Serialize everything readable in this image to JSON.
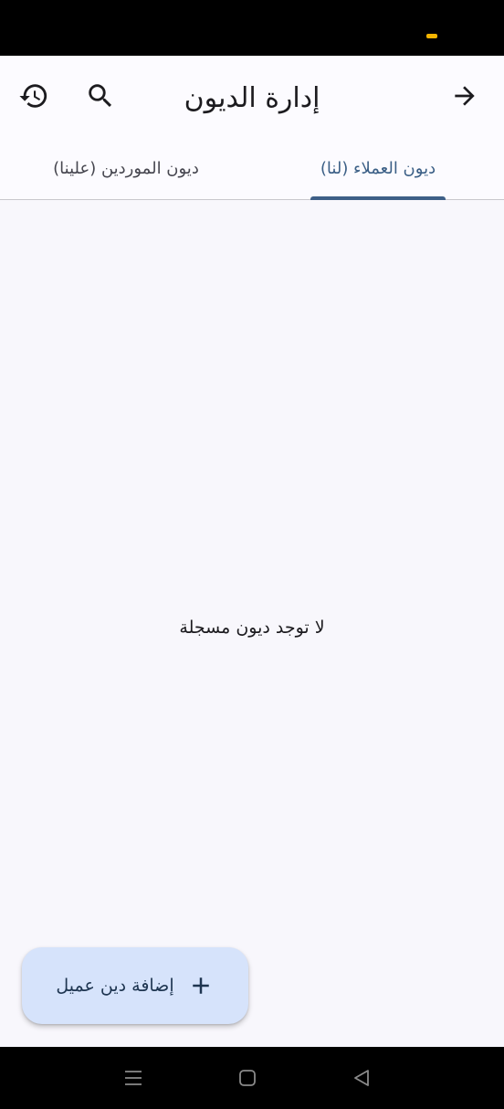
{
  "header": {
    "title": "إدارة الديون",
    "back_icon": "arrow-forward-icon",
    "search_icon": "search-icon",
    "history_icon": "history-icon"
  },
  "tabs": [
    {
      "label": "ديون العملاء (لنا)",
      "selected": true
    },
    {
      "label": "ديون الموردين (علينا)",
      "selected": false
    }
  ],
  "content": {
    "empty_message": "لا توجد ديون مسجلة"
  },
  "fab": {
    "label": "إضافة دين عميل",
    "icon": "plus-icon"
  },
  "colors": {
    "accent": "#3e5f87",
    "fab_background": "#d6e3fb",
    "background": "#f8f7fc",
    "status_dot": "#f4b400"
  },
  "system_nav": {
    "recents_icon": "menu-lines-icon",
    "home_icon": "square-home-icon",
    "back_icon": "triangle-back-icon"
  }
}
